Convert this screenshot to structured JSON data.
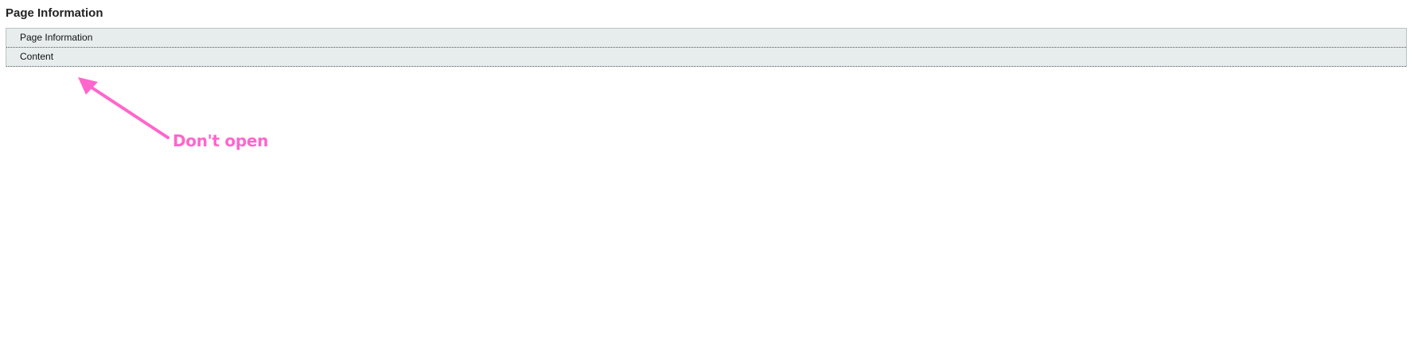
{
  "page": {
    "title": "Page Information"
  },
  "sections": [
    {
      "label": "Page Information"
    },
    {
      "label": "Content"
    }
  ],
  "annotation": {
    "text": "Don't open",
    "color": "#ff66cc"
  },
  "colors": {
    "panel_background": "#e7eded",
    "panel_border": "#b9c4c4"
  }
}
